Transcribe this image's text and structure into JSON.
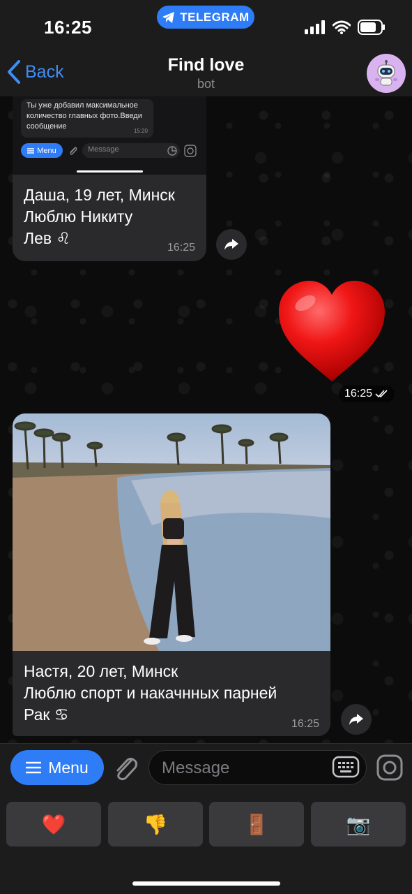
{
  "status_bar": {
    "time": "16:25",
    "pill_label": "TELEGRAM",
    "icons": [
      "signal-icon",
      "wifi-icon",
      "battery-icon"
    ]
  },
  "header": {
    "back_label": "Back",
    "title": "Find love",
    "subtitle": "bot"
  },
  "messages": [
    {
      "screenshot": {
        "message_text": "Ты уже добавил максимальное количество главных фото.Введи сообщение",
        "message_time": "15:20",
        "menu_label": "Menu",
        "input_placeholder": "Message"
      },
      "caption_lines": [
        "Даша, 19 лет, Минск",
        "Люблю Никиту",
        "Лев ♌"
      ],
      "time": "16:25"
    },
    {
      "sticker": "red-heart",
      "time": "16:25"
    },
    {
      "caption_lines": [
        "Настя, 20 лет, Минск",
        "Люблю спорт и накачнных парней",
        "Рак ♋"
      ],
      "time": "16:25"
    }
  ],
  "input_bar": {
    "menu_label": "Menu",
    "placeholder": "Message"
  },
  "reply_keyboard": [
    "❤️",
    "👎",
    "🚪",
    "📷"
  ],
  "colors": {
    "accent": "#2e7cf6",
    "bubble": "#2a2a2c",
    "bar": "#1c1c1d"
  }
}
